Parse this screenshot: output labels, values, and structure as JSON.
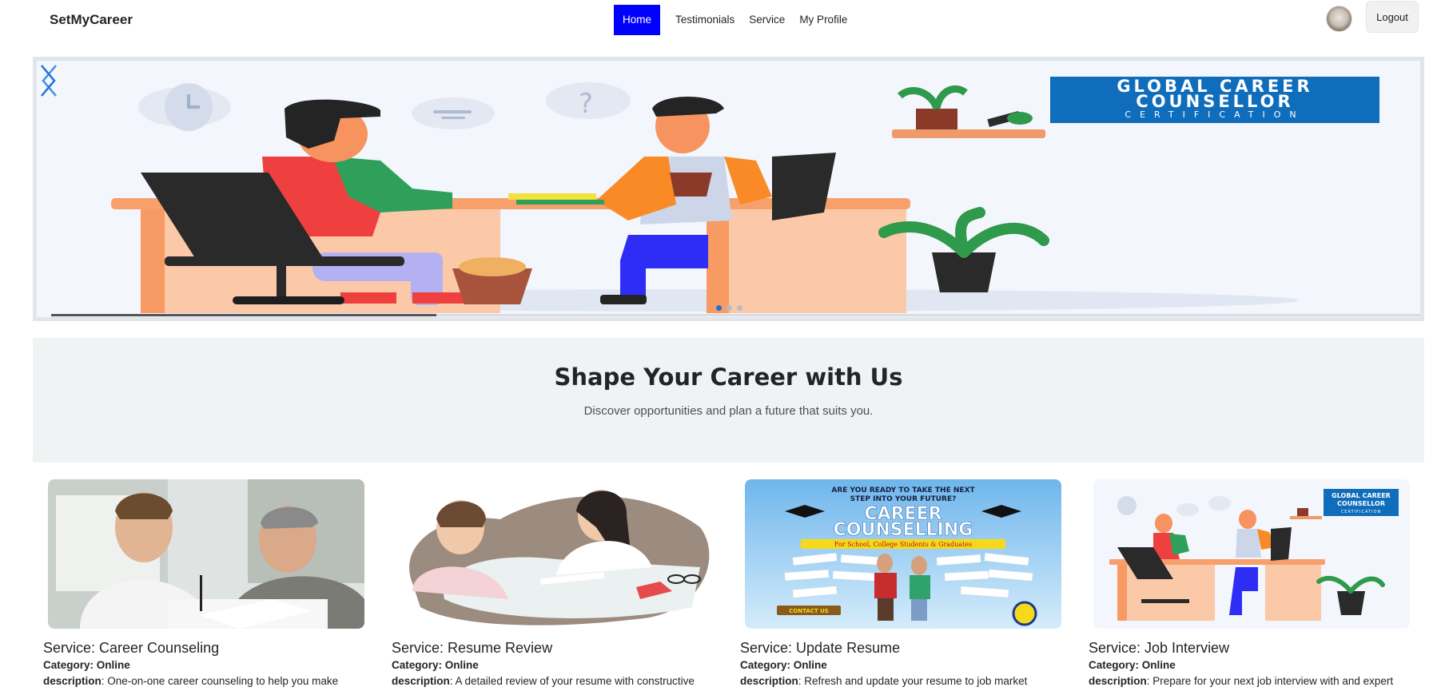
{
  "navbar": {
    "brand": "SetMyCareer",
    "links": [
      {
        "label": "Home",
        "active": true
      },
      {
        "label": "Testimonials",
        "active": false
      },
      {
        "label": "Service",
        "active": false
      },
      {
        "label": "My Profile",
        "active": false
      }
    ],
    "logout_label": "Logout"
  },
  "carousel": {
    "banner": {
      "line1": "GLOBAL CAREER",
      "line2": "COUNSELLOR",
      "line3": "CERTIFICATION"
    },
    "slide_count": 3,
    "active_slide": 1,
    "progress": 0.28
  },
  "hero": {
    "title": "Shape Your Career with Us",
    "subtitle": "Discover opportunities and plan a future that suits you."
  },
  "services": [
    {
      "title": "Service: Career Counseling",
      "category_label": "Category:",
      "category": "Online",
      "description_label": "description",
      "description": ": One-on-one career counseling to help you make"
    },
    {
      "title": "Service: Resume Review",
      "category_label": "Category:",
      "category": "Online",
      "description_label": "description",
      "description": ": A detailed review of your resume with constructive"
    },
    {
      "title": "Service: Update Resume",
      "category_label": "Category:",
      "category": "Online",
      "description_label": "description",
      "description": ": Refresh and update your resume to job market"
    },
    {
      "title": "Service: Job Interview",
      "category_label": "Category:",
      "category": "Online",
      "description_label": "description",
      "description": ": Prepare for your next job interview with and expert"
    }
  ],
  "card3_poster": {
    "headline1": "ARE YOU READY TO TAKE THE NEXT",
    "headline2": "STEP INTO YOUR FUTURE?",
    "title1": "CAREER",
    "title2": "COUNSELLING",
    "strip": "For School, College Students & Graduates",
    "contact": "CONTACT US"
  },
  "card4_banner": {
    "line1": "GLOBAL CAREER",
    "line2": "COUNSELLOR",
    "line3": "CERTIFICATION"
  },
  "colors": {
    "nav_active": "#0000ff",
    "banner_blue": "#0f6dbb",
    "indicator_active": "#1e6fd9"
  }
}
